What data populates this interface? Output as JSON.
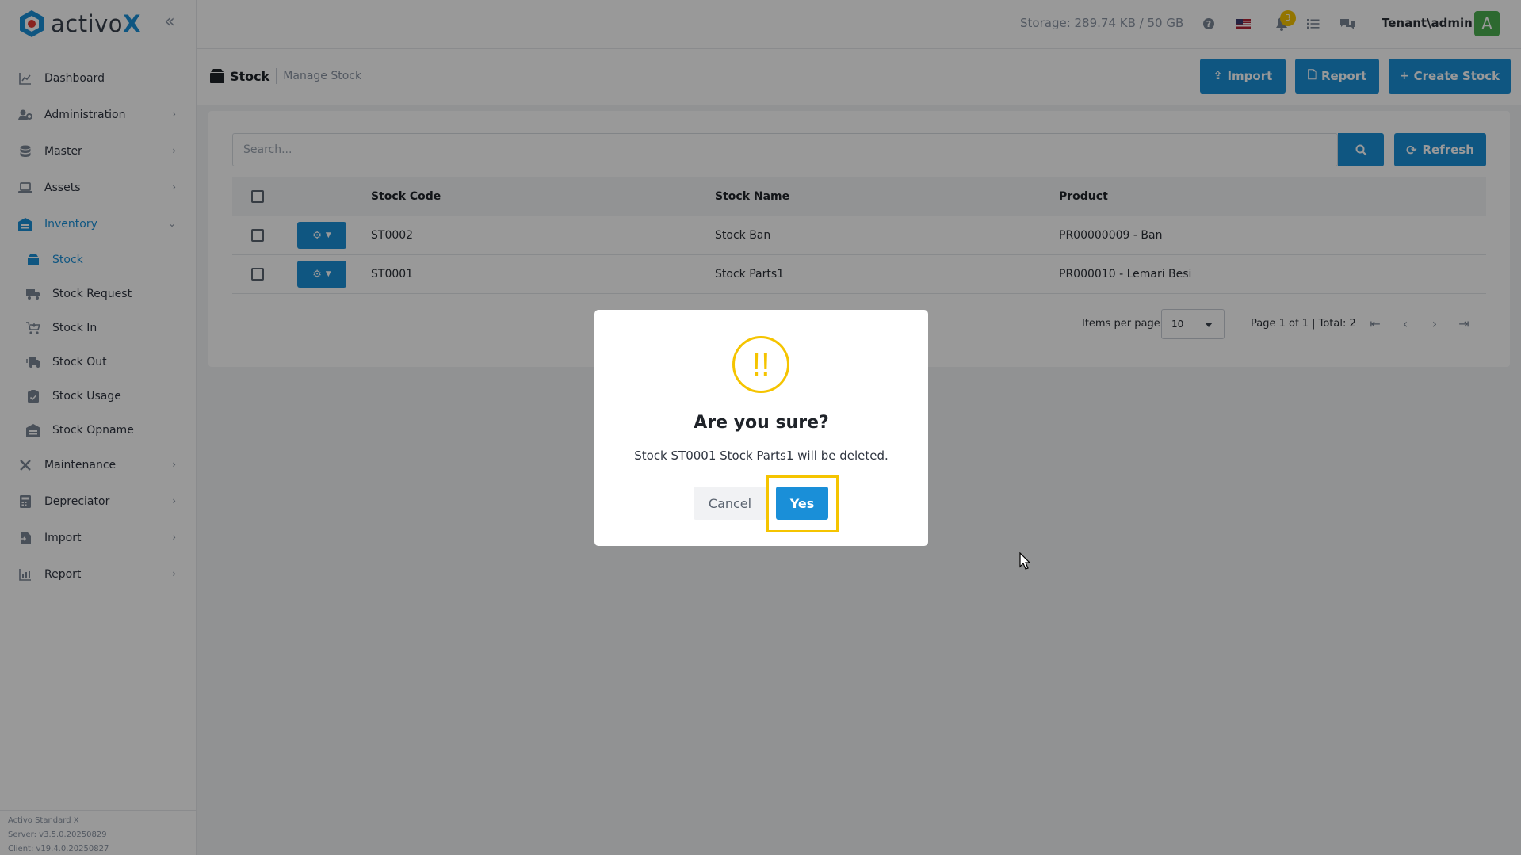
{
  "app": {
    "logo_text": "activo",
    "logo_x": "X",
    "collapse_icon": "double-chevron-left-icon"
  },
  "topbar": {
    "storage": "Storage: 289.74 KB / 50 GB",
    "notifications_count": "3",
    "user": "Tenant\\admin",
    "avatar_letter": "A"
  },
  "sidebar": {
    "items": [
      {
        "label": "Dashboard",
        "icon": "chart-line-icon"
      },
      {
        "label": "Administration",
        "icon": "users-cog-icon"
      },
      {
        "label": "Master",
        "icon": "database-icon"
      },
      {
        "label": "Assets",
        "icon": "laptop-icon"
      },
      {
        "label": "Inventory",
        "icon": "warehouse-icon"
      },
      {
        "label": "Maintenance",
        "icon": "tools-icon"
      },
      {
        "label": "Depreciator",
        "icon": "calculator-icon"
      },
      {
        "label": "Import",
        "icon": "file-import-icon"
      },
      {
        "label": "Report",
        "icon": "chart-bar-icon"
      }
    ],
    "inventory_sub": [
      {
        "label": "Stock"
      },
      {
        "label": "Stock Request"
      },
      {
        "label": "Stock In"
      },
      {
        "label": "Stock Out"
      },
      {
        "label": "Stock Usage"
      },
      {
        "label": "Stock Opname"
      }
    ],
    "version": {
      "product": "Activo Standard X",
      "server": "Server: v3.5.0.20250829",
      "client": "Client: v19.4.0.20250827"
    }
  },
  "page": {
    "title": "Stock",
    "subtitle": "Manage Stock",
    "import_label": "Import",
    "report_label": "Report",
    "create_label": "Create Stock"
  },
  "search": {
    "placeholder": "Search...",
    "refresh_label": "Refresh"
  },
  "table": {
    "headers": {
      "code": "Stock Code",
      "name": "Stock Name",
      "product": "Product"
    },
    "rows": [
      {
        "code": "ST0002",
        "name": "Stock Ban",
        "product": "PR00000009 - Ban"
      },
      {
        "code": "ST0001",
        "name": "Stock Parts1",
        "product": "PR000010 - Lemari Besi"
      }
    ]
  },
  "pager": {
    "items_per_page_label": "Items per page",
    "items_per_page": "10",
    "info": "Page 1 of 1 | Total: 2"
  },
  "modal": {
    "icon_text": "!!",
    "title": "Are you sure?",
    "message": "Stock ST0001 Stock Parts1 will be deleted.",
    "cancel_label": "Cancel",
    "yes_label": "Yes"
  },
  "colors": {
    "primary": "#1a8fd8",
    "warning": "#f5c400",
    "avatar": "#4caf50"
  }
}
